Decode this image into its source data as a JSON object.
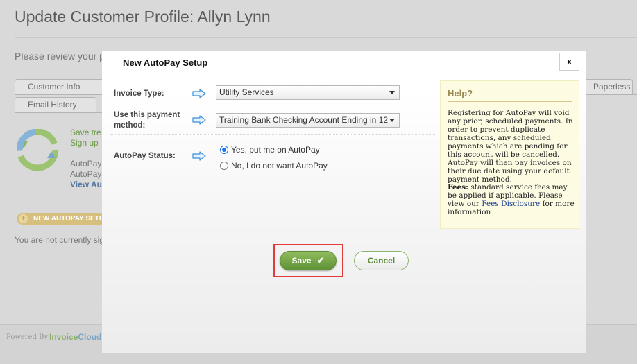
{
  "background": {
    "page_title": "Update Customer Profile: Allyn Lynn",
    "review_text": "Please review your p",
    "tabs": [
      "Customer Info",
      "Email History",
      "Paperless"
    ],
    "save_link": "Save tre",
    "signup_link": "Sign up",
    "autopay_line_1": "AutoPay",
    "autopay_line_2": "AutoPay",
    "view_link": "View Au",
    "new_autopay_button": "NEW AUTOPAY SETUP",
    "not_signed_text": "You are not currently sig",
    "powered_by": "Powered By",
    "brand_invoice": "Invoice",
    "brand_cloud": "Cloud"
  },
  "modal": {
    "title": "New AutoPay Setup",
    "close_label": "x",
    "fields": {
      "invoice_type_label": "Invoice Type:",
      "invoice_type_value": "Utility Services",
      "payment_method_label_1": "Use this payment",
      "payment_method_label_2": "method:",
      "payment_method_value": "Training Bank Checking Account Ending in 12",
      "autopay_status_label": "AutoPay Status:",
      "autopay_yes": "Yes, put me on AutoPay",
      "autopay_no": "No, I do not want AutoPay",
      "autopay_selected": "yes"
    },
    "help": {
      "title": "Help?",
      "body": "Registering for AutoPay will void any prior, scheduled payments. In order to prevent duplicate transactions, any scheduled payments which are pending for this account will be cancelled. AutoPay will then pay invoices on their due date using your default payment method.",
      "fees_label": "Fees:",
      "fees_text": " standard service fees may be applied if applicable. Please view our ",
      "fees_link": "Fees Disclosure",
      "fees_after": " for more information"
    },
    "buttons": {
      "save": "Save",
      "cancel": "Cancel"
    }
  },
  "colors": {
    "accent_green": "#6b9a46",
    "highlight_red": "#e23b3b",
    "arrow_blue": "#3a8fd8",
    "help_bg": "#fdfbe2"
  },
  "icons": {
    "arrow": "arrow-right-icon",
    "check": "check-icon",
    "sync": "sync-icon"
  }
}
